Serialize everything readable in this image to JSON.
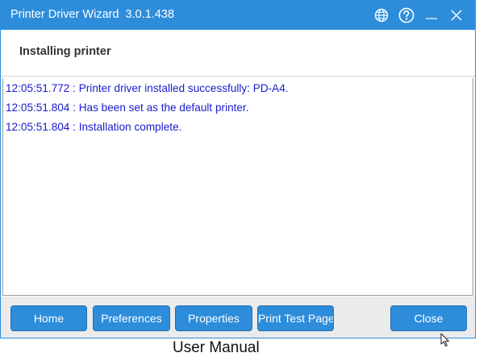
{
  "window": {
    "title": "Printer Driver Wizard",
    "version": "3.0.1.438",
    "icons": [
      "globe-icon",
      "help-icon",
      "minimize-icon",
      "close-icon"
    ]
  },
  "header": {
    "title": "Installing printer"
  },
  "log": {
    "lines": [
      "12:05:51.772 : Printer driver installed successfully: PD-A4.",
      "12:05:51.804 : Has been set as the default printer.",
      "12:05:51.804 : Installation complete."
    ]
  },
  "footer": {
    "buttons": {
      "home": "Home",
      "preferences": "Preferences",
      "properties": "Properties",
      "print_test_page": "Print Test Page",
      "close": "Close"
    }
  },
  "background": {
    "caption": "User Manual"
  },
  "colors": {
    "accent": "#2d8ddb",
    "log_text": "#1a1acf",
    "footer_bg": "#ebebeb"
  }
}
